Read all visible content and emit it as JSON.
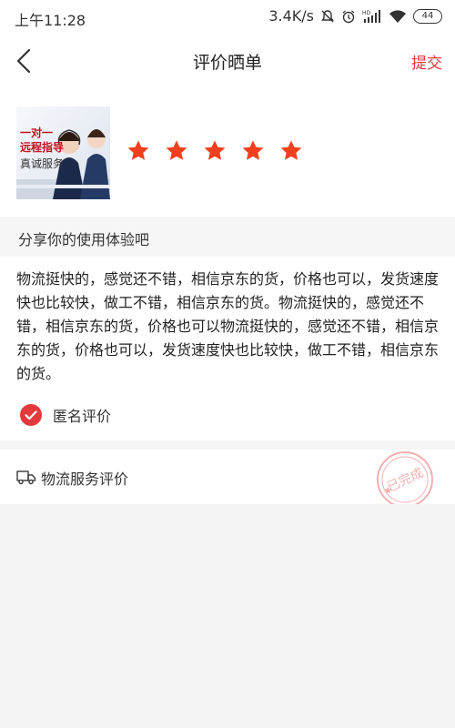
{
  "status_bar": {
    "time": "上午11:28",
    "speed": "3.4K/s",
    "battery": "44"
  },
  "header": {
    "title": "评价晒单",
    "submit_label": "提交",
    "accent_color": "#e4393c"
  },
  "product": {
    "thumb_lines": [
      "一对一",
      "远程指导",
      "真诚服务"
    ],
    "rating": 5,
    "star_color": "#f0401e"
  },
  "share": {
    "label": "分享你的使用体验吧"
  },
  "review": {
    "text": "物流挺快的，感觉还不错，相信京东的货，价格也可以，发货速度快也比较快，做工不错，相信京东的货。物流挺快的，感觉还不错，相信京东的货，价格也可以物流挺快的，感觉还不错，相信京东的货，价格也可以，发货速度快也比较快，做工不错，相信京东的货。",
    "anonymous_label": "匿名评价",
    "anonymous_checked": true
  },
  "logistics": {
    "label": "物流服务评价",
    "stamp_text": "已完成"
  }
}
